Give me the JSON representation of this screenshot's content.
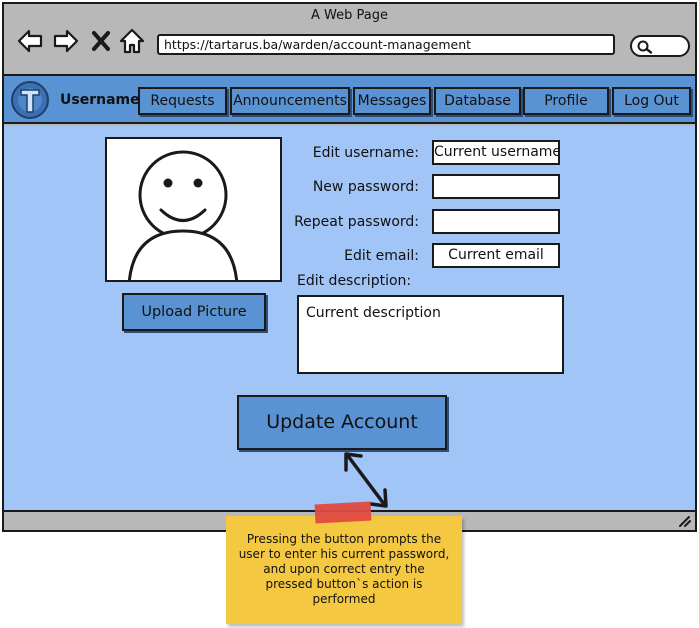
{
  "window": {
    "title": "A Web Page",
    "url": "https://tartarus.ba/warden/account-management"
  },
  "navbar": {
    "username": "Username",
    "items": [
      {
        "label": "Requests"
      },
      {
        "label": "Announcements"
      },
      {
        "label": "Messages"
      },
      {
        "label": "Database"
      },
      {
        "label": "Profile"
      },
      {
        "label": "Log Out"
      }
    ]
  },
  "profile": {
    "upload_label": "Upload Picture"
  },
  "form": {
    "edit_username_label": "Edit username:",
    "edit_username_value": "Current username",
    "new_password_label": "New password:",
    "new_password_value": "",
    "repeat_password_label": "Repeat password:",
    "repeat_password_value": "",
    "edit_email_label": "Edit email:",
    "edit_email_value": "Current email",
    "edit_description_label": "Edit description:",
    "edit_description_value": "Current description"
  },
  "actions": {
    "update_label": "Update Account"
  },
  "annotation": {
    "text": "Pressing the button prompts the user to enter his current password, and upon correct entry the pressed button`s action is performed"
  },
  "colors": {
    "accent": "#5a93d4",
    "content_bg": "#a2c5f7",
    "chrome": "#b8b8b8",
    "note": "#f5c842",
    "tape": "#e04a3f"
  },
  "icons": {
    "back": "arrow-left-icon",
    "forward": "arrow-right-icon",
    "stop": "close-icon",
    "home": "home-icon",
    "search": "search-icon",
    "logo": "tartarus-logo",
    "resize": "resize-grip-icon"
  }
}
